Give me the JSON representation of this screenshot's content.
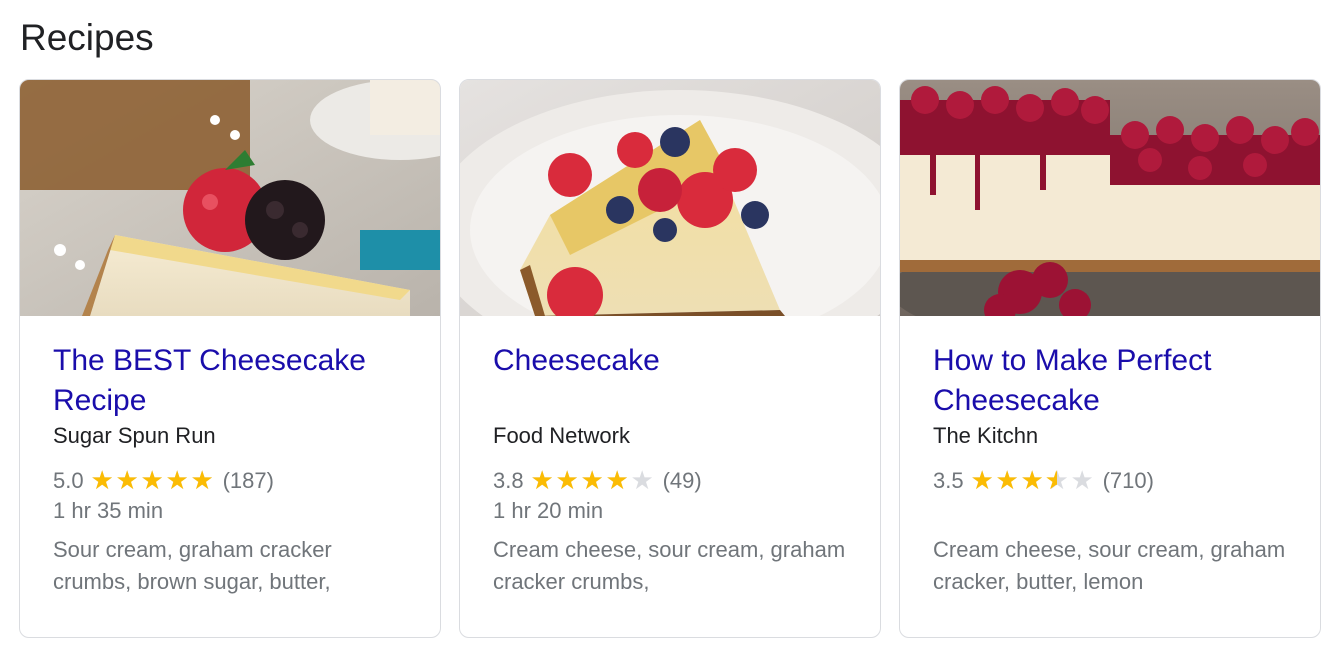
{
  "section": {
    "title": "Recipes"
  },
  "colors": {
    "link": "#1a0dab",
    "star": "#fbbc04",
    "star_empty": "#dadce0",
    "meta": "#70757a"
  },
  "cards": [
    {
      "title": "The BEST Cheesecake Recipe",
      "source": "Sugar Spun Run",
      "rating": "5.0",
      "rating_value": 5.0,
      "reviews": "(187)",
      "time": "1 hr 35 min",
      "ingredients": "Sour cream, graham cracker crumbs, brown sugar, butter,"
    },
    {
      "title": "Cheesecake",
      "source": "Food Network",
      "rating": "3.8",
      "rating_value": 3.8,
      "reviews": "(49)",
      "time": "1 hr 20 min",
      "ingredients": "Cream cheese, sour cream, graham cracker crumbs,"
    },
    {
      "title": "How to Make Perfect Cheesecake",
      "source": "The Kitchn",
      "rating": "3.5",
      "rating_value": 3.5,
      "reviews": "(710)",
      "time": "",
      "ingredients": "Cream cheese, sour cream, graham cracker, butter, lemon"
    }
  ]
}
